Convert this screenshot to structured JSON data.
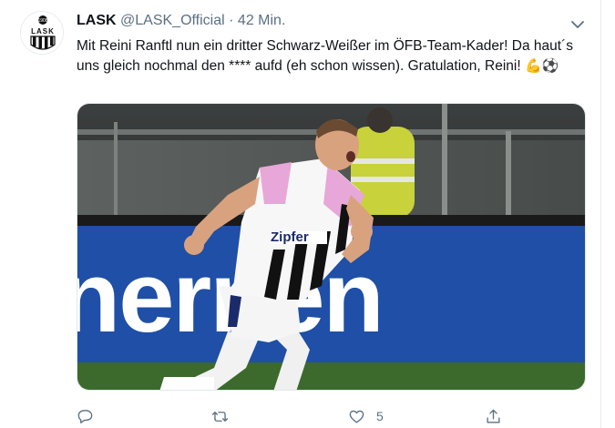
{
  "tweet": {
    "author_name": "LASK",
    "handle": "@LASK_Official",
    "separator": "·",
    "time": "42 Min.",
    "text": "Mit Reini Ranftl nun ein dritter Schwarz-Weißer im ÖFB-Team-Kader! Da haut´s uns gleich nochmal den **** aufd (eh schon wissen). Gratulation, Reini!",
    "emojis": "💪⚽",
    "likes": "5"
  },
  "avatar": {
    "logo_text": "LASK"
  },
  "media": {
    "banner_text": "nernen",
    "shirt_sponsor": "Zipfer",
    "colors": {
      "banner": "#1f4fa6",
      "shirt_pink": "#e7a7d8",
      "grass": "#3b6a2c"
    }
  },
  "icons": {
    "caret": "chevron-down-icon",
    "reply": "reply-icon",
    "retweet": "retweet-icon",
    "like": "heart-icon",
    "share": "share-icon"
  },
  "colors": {
    "text": "#0f1419",
    "secondary": "#5b7083",
    "border": "#e6ecf0"
  }
}
